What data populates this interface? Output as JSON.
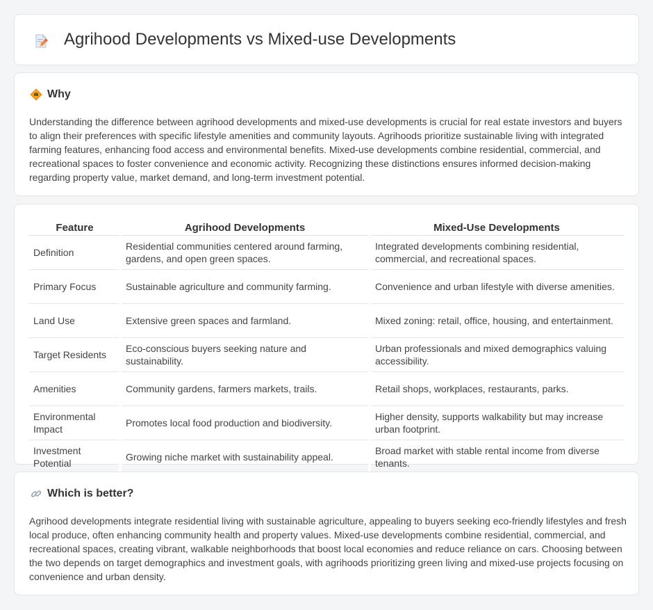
{
  "header": {
    "title": "Agrihood Developments vs Mixed-use Developments",
    "icon": "document-pencil-icon"
  },
  "why": {
    "title": "Why",
    "icon": "diamond-signal-icon",
    "text": "Understanding the difference between agrihood developments and mixed-use developments is crucial for real estate investors and buyers to align their preferences with specific lifestyle amenities and community layouts. Agrihoods prioritize sustainable living with integrated farming features, enhancing food access and environmental benefits. Mixed-use developments combine residential, commercial, and recreational spaces to foster convenience and economic activity. Recognizing these distinctions ensures informed decision-making regarding property value, market demand, and long-term investment potential."
  },
  "table": {
    "headers": [
      "Feature",
      "Agrihood Developments",
      "Mixed-Use Developments"
    ],
    "rows": [
      [
        "Definition",
        "Residential communities centered around farming, gardens, and open green spaces.",
        "Integrated developments combining residential, commercial, and recreational spaces."
      ],
      [
        "Primary Focus",
        "Sustainable agriculture and community farming.",
        "Convenience and urban lifestyle with diverse amenities."
      ],
      [
        "Land Use",
        "Extensive green spaces and farmland.",
        "Mixed zoning: retail, office, housing, and entertainment."
      ],
      [
        "Target Residents",
        "Eco-conscious buyers seeking nature and sustainability.",
        "Urban professionals and mixed demographics valuing accessibility."
      ],
      [
        "Amenities",
        "Community gardens, farmers markets, trails.",
        "Retail shops, workplaces, restaurants, parks."
      ],
      [
        "Environmental Impact",
        "Promotes local food production and biodiversity.",
        "Higher density, supports walkability but may increase urban footprint."
      ],
      [
        "Investment Potential",
        "Growing niche market with sustainability appeal.",
        "Broad market with stable rental income from diverse tenants."
      ]
    ]
  },
  "better": {
    "title": "Which is better?",
    "icon": "link-icon",
    "text": "Agrihood developments integrate residential living with sustainable agriculture, appealing to buyers seeking eco-friendly lifestyles and fresh local produce, often enhancing community health and property values. Mixed-use developments combine residential, commercial, and recreational spaces, creating vibrant, walkable neighborhoods that boost local economies and reduce reliance on cars. Choosing between the two depends on target demographics and investment goals, with agrihoods prioritizing green living and mixed-use projects focusing on convenience and urban density."
  }
}
